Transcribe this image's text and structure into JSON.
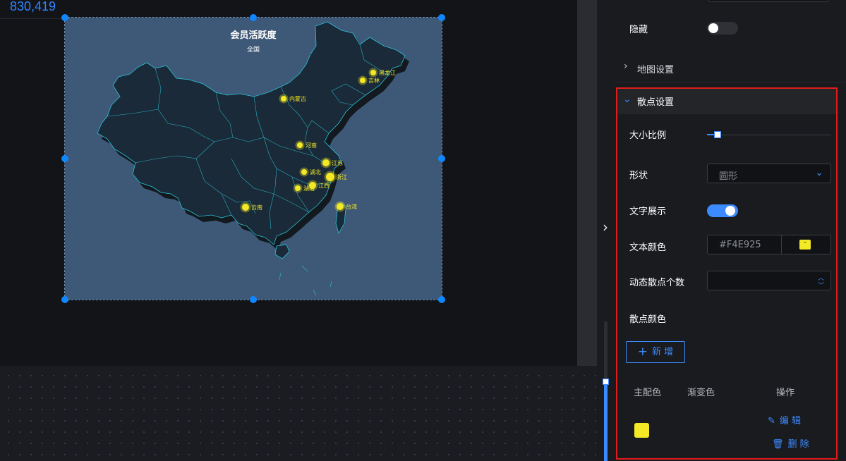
{
  "canvas": {
    "coords": "830,419",
    "widget": {
      "title": "会员活跃度",
      "subtitle": "全国",
      "map_fill": "#1a2a38",
      "map_stroke": "#2cc3d8",
      "background": "#3e5877",
      "point_color": "#f4e925",
      "points": [
        {
          "label": "黑龙江"
        },
        {
          "label": "吉林"
        },
        {
          "label": "内蒙古"
        },
        {
          "label": "河南"
        },
        {
          "label": "江苏"
        },
        {
          "label": "湖北"
        },
        {
          "label": "浙江"
        },
        {
          "label": "湖南"
        },
        {
          "label": "江西"
        },
        {
          "label": "云南"
        },
        {
          "label": "台湾"
        }
      ]
    }
  },
  "panel": {
    "hidden_label": "隐藏",
    "hidden_on": false,
    "map_section": {
      "title": "地图设置",
      "icon": "chevron-right-icon"
    },
    "scatter_section": {
      "title": "散点设置",
      "icon": "chevron-down-icon",
      "size_ratio_label": "大小比例",
      "size_ratio_value": 0.08,
      "shape_label": "形状",
      "shape_value": "圆形",
      "text_display_label": "文字展示",
      "text_display_on": true,
      "text_color_label": "文本颜色",
      "text_color_value": "#F4E925",
      "dynamic_count_label": "动态散点个数",
      "dynamic_count_value": "",
      "scatter_color_label": "散点颜色",
      "add_button": "新 增",
      "table": {
        "headers": [
          "主配色",
          "渐变色",
          "操作"
        ],
        "rows": [
          {
            "main_color": "#f4e925",
            "gradient": "",
            "edit": "编 辑",
            "delete": "删 除"
          }
        ]
      }
    }
  },
  "colors": {
    "accent": "#3b8bff",
    "highlight": "#e21b1b",
    "switch_off": "#2f3136"
  }
}
